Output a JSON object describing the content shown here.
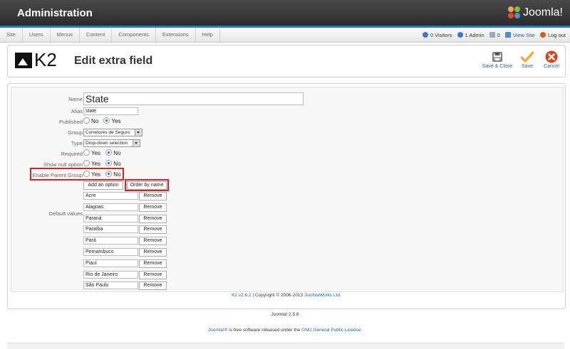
{
  "header": {
    "title": "Administration",
    "brand": "Joomla!"
  },
  "menu": [
    "Site",
    "Users",
    "Menus",
    "Content",
    "Components",
    "Extensions",
    "Help"
  ],
  "status": {
    "visitors": "0 Visitors",
    "admins": "1 Admin",
    "messages": "0",
    "view_site": "View Site",
    "logout": "Log out"
  },
  "toolbar": {
    "logo": "K2",
    "page_title": "Edit extra field",
    "save_close": "Save & Close",
    "save": "Save",
    "cancel": "Cancel"
  },
  "form": {
    "name_label": "Name",
    "name_value": "State",
    "alias_label": "Alias",
    "alias_value": "state",
    "published_label": "Published",
    "published_no": "No",
    "published_yes": "Yes",
    "group_label": "Group",
    "group_value": "Corretores de Seguro",
    "type_label": "Type",
    "type_value": "Drop-down selection",
    "required_label": "Required",
    "required_yes": "Yes",
    "required_no": "No",
    "nulloption_label": "Show null option",
    "nulloption_yes": "Yes",
    "nulloption_no": "No",
    "parentgroup_label": "Enable Parent Group",
    "parentgroup_yes": "Yes",
    "parentgroup_no": "No",
    "add_option": "Add an option",
    "order_by_name": "Order by name",
    "default_values_label": "Default values",
    "remove_label": "Remove",
    "options": [
      "Acre",
      "Alagoas",
      "Paraná",
      "Paraíba",
      "Pará",
      "Pernambuco",
      "Piauí",
      "Rio de Janeiro",
      "São Paulo"
    ]
  },
  "copyright": {
    "version": "K2 v2.6.2",
    "text": " | Copyright © 2006-2013 ",
    "company": "JoomlaWorks Ltd."
  },
  "footer": {
    "version": "Joomla! 2.5.8",
    "brand": "Joomla!®",
    "text": " is free software released under the ",
    "license": "GNU General Public License",
    "end": "."
  }
}
